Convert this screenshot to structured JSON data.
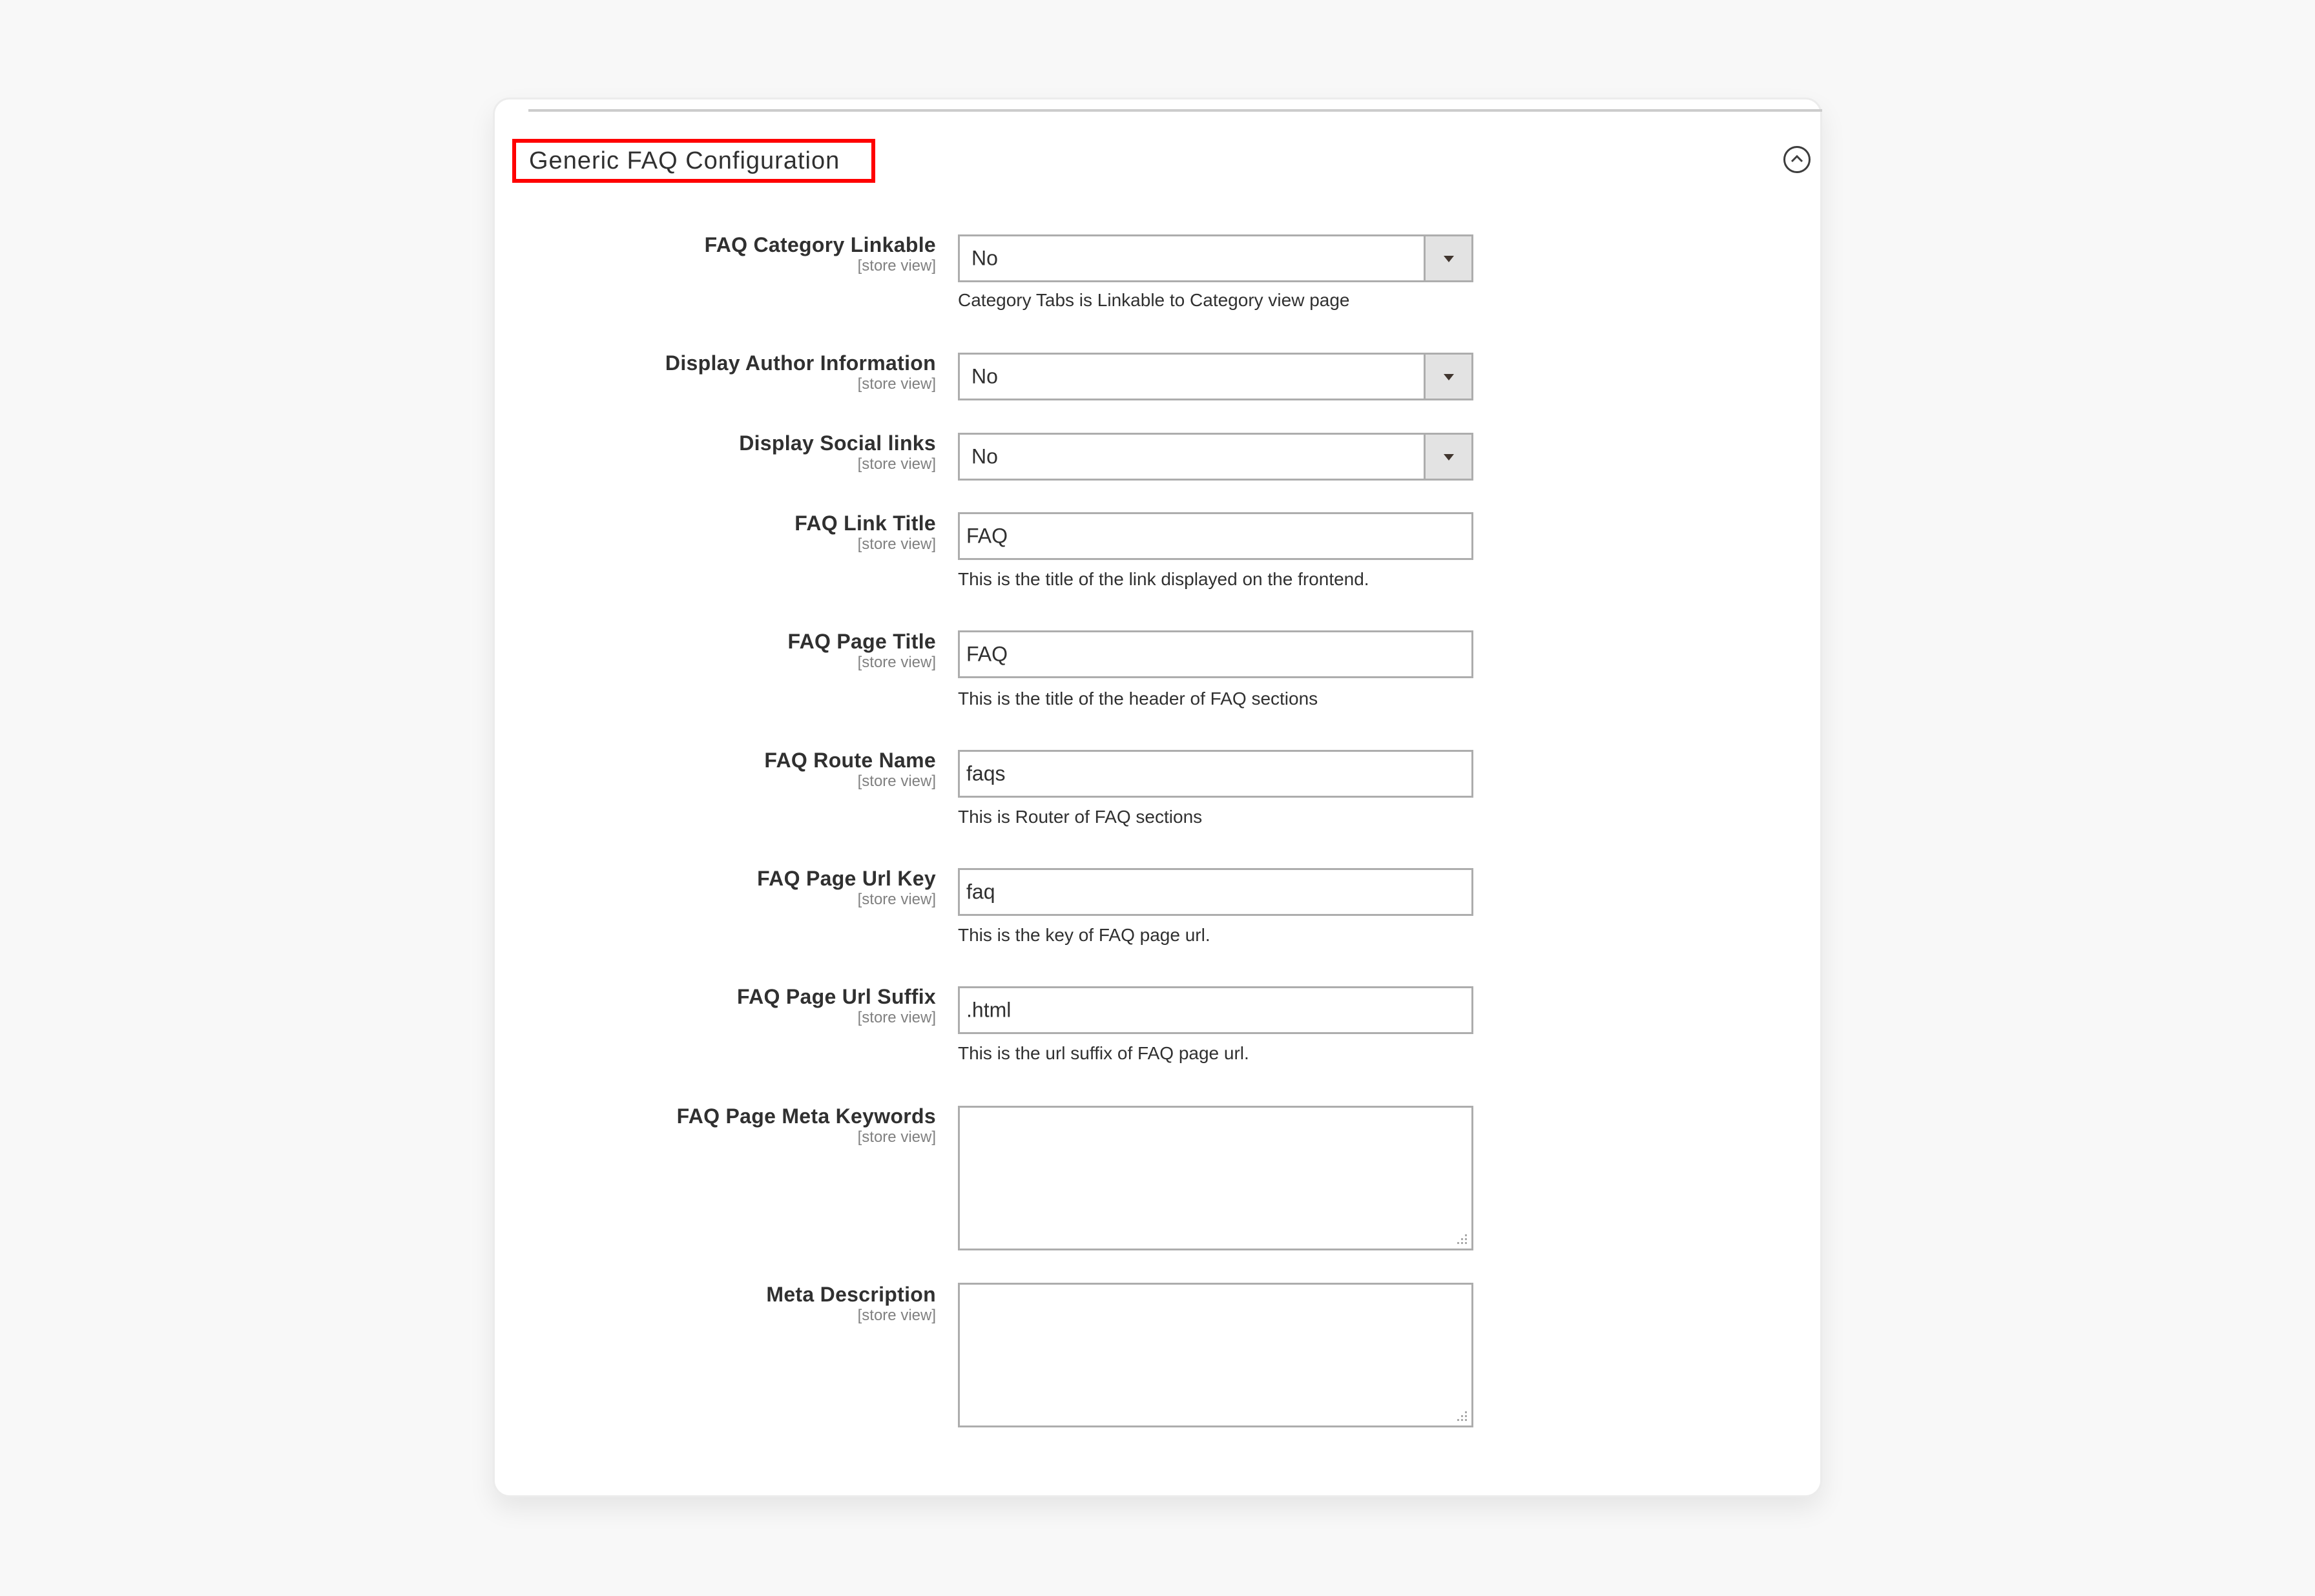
{
  "section": {
    "title": "Generic FAQ Configuration",
    "collapse_icon": "chevron-up-circle-icon",
    "highlight_color": "#ff0000"
  },
  "fields": [
    {
      "label": "FAQ Category Linkable",
      "scope": "[store view]",
      "type": "select",
      "value": "No",
      "note": "Category Tabs is Linkable to Category view page"
    },
    {
      "label": "Display Author Information",
      "scope": "[store view]",
      "type": "select",
      "value": "No",
      "note": ""
    },
    {
      "label": "Display Social links",
      "scope": "[store view]",
      "type": "select",
      "value": "No",
      "note": ""
    },
    {
      "label": "FAQ Link Title",
      "scope": "[store view]",
      "type": "text",
      "value": "FAQ",
      "note": "This is the title of the link displayed on the frontend."
    },
    {
      "label": "FAQ Page Title",
      "scope": "[store view]",
      "type": "text",
      "value": "FAQ",
      "note": "This is the title of the header of FAQ sections"
    },
    {
      "label": "FAQ Route Name",
      "scope": "[store view]",
      "type": "text",
      "value": "faqs",
      "note": "This is Router of FAQ sections"
    },
    {
      "label": "FAQ Page Url Key",
      "scope": "[store view]",
      "type": "text",
      "value": "faq",
      "note": "This is the key of FAQ page url."
    },
    {
      "label": "FAQ Page Url Suffix",
      "scope": "[store view]",
      "type": "text",
      "value": ".html",
      "note": "This is the url suffix of FAQ page url."
    },
    {
      "label": "FAQ Page Meta Keywords",
      "scope": "[store view]",
      "type": "textarea",
      "value": "",
      "note": ""
    },
    {
      "label": "Meta Description",
      "scope": "[store view]",
      "type": "textarea",
      "value": "",
      "note": ""
    }
  ]
}
